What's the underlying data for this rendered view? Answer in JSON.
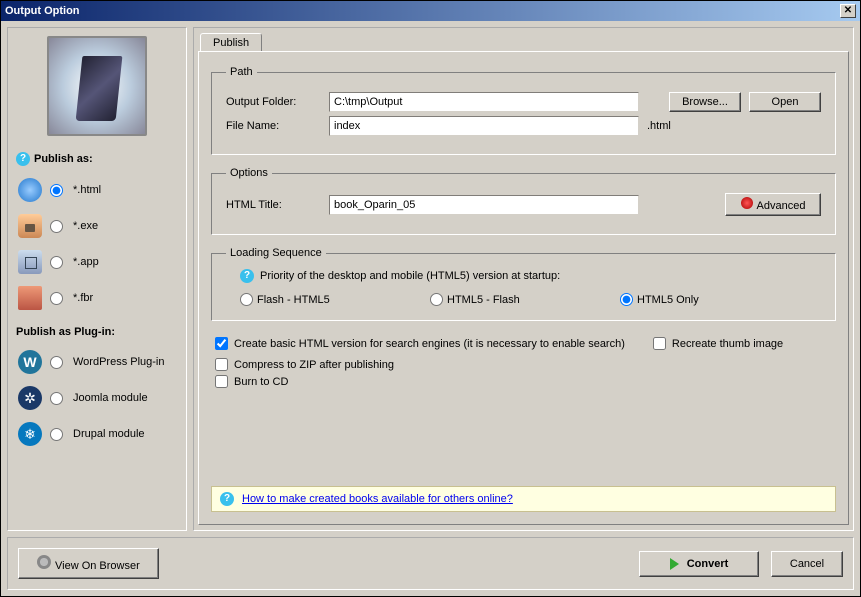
{
  "window": {
    "title": "Output Option"
  },
  "sidebar": {
    "publish_as_label": "Publish as:",
    "formats": [
      {
        "id": "html",
        "label": "*.html",
        "checked": true
      },
      {
        "id": "exe",
        "label": "*.exe",
        "checked": false
      },
      {
        "id": "app",
        "label": "*.app",
        "checked": false
      },
      {
        "id": "fbr",
        "label": "*.fbr",
        "checked": false
      }
    ],
    "plugin_label": "Publish as Plug-in:",
    "plugins": [
      {
        "id": "wp",
        "label": "WordPress Plug-in",
        "glyph": "W"
      },
      {
        "id": "joomla",
        "label": "Joomla module",
        "glyph": "✲"
      },
      {
        "id": "drupal",
        "label": "Drupal module",
        "glyph": "❄"
      }
    ]
  },
  "tabs": {
    "publish": "Publish"
  },
  "path": {
    "legend": "Path",
    "output_folder_label": "Output Folder:",
    "output_folder_value": "C:\\tmp\\Output",
    "file_name_label": "File Name:",
    "file_name_value": "index",
    "file_ext": ".html",
    "browse": "Browse...",
    "open": "Open"
  },
  "options": {
    "legend": "Options",
    "html_title_label": "HTML Title:",
    "html_title_value": "book_Oparin_05",
    "advanced": "Advanced"
  },
  "loading": {
    "legend": "Loading Sequence",
    "priority_text": "Priority of the desktop and mobile (HTML5) version at startup:",
    "opt1": "Flash - HTML5",
    "opt2": "HTML5 - Flash",
    "opt3": "HTML5 Only",
    "selected": "opt3"
  },
  "checks": {
    "basic_html": {
      "label": "Create basic HTML version for search engines (it is necessary to enable search)",
      "checked": true
    },
    "recreate_thumb": {
      "label": "Recreate thumb image",
      "checked": false
    },
    "compress_zip": {
      "label": "Compress to ZIP after publishing",
      "checked": false
    },
    "burn_cd": {
      "label": "Burn to CD",
      "checked": false
    }
  },
  "help_link": "How to make created books available for others online?",
  "buttons": {
    "view_browser": "View On Browser",
    "convert": "Convert",
    "cancel": "Cancel"
  }
}
